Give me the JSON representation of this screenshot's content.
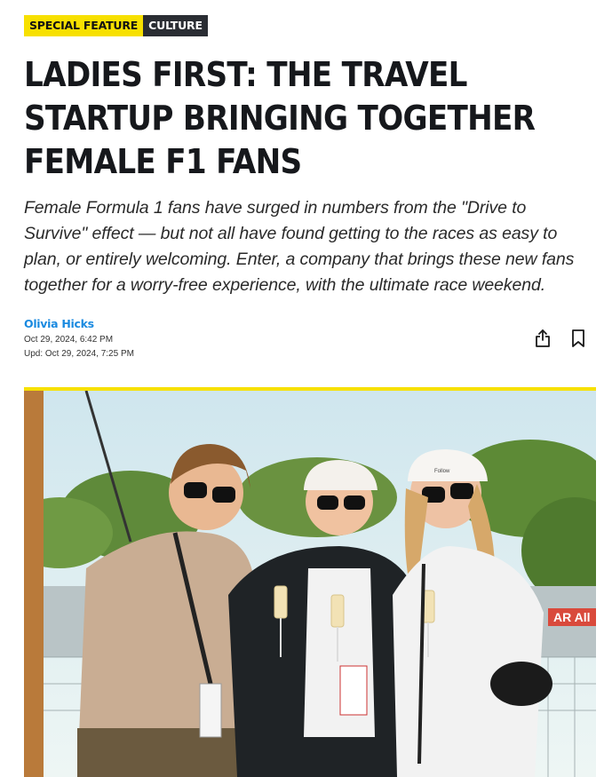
{
  "tags": {
    "special": "SPECIAL FEATURE",
    "category": "CULTURE",
    "special_color": "#f7e000",
    "category_color": "#2a2d33"
  },
  "article": {
    "headline": "LADIES FIRST: THE TRAVEL STARTUP BRINGING TOGETHER FEMALE F1 FANS",
    "dek": "Female Formula 1 fans have surged in numbers from the \"Drive to Survive\" effect — but not all have found getting to the races as easy to plan, or entirely welcoming. Enter, a company that brings these new fans together for a worry-free experience, with the ultimate race weekend."
  },
  "byline": {
    "author": "Olivia Hicks",
    "published": "Oct 29, 2024, 6:42 PM",
    "updated": "Upd: Oct 29, 2024, 7:25 PM",
    "author_color": "#1a8ae0"
  },
  "actions": {
    "share_icon": "share-icon",
    "bookmark_icon": "bookmark-icon"
  },
  "hero": {
    "banner_text": "AR All",
    "cap_text": "Follow"
  }
}
